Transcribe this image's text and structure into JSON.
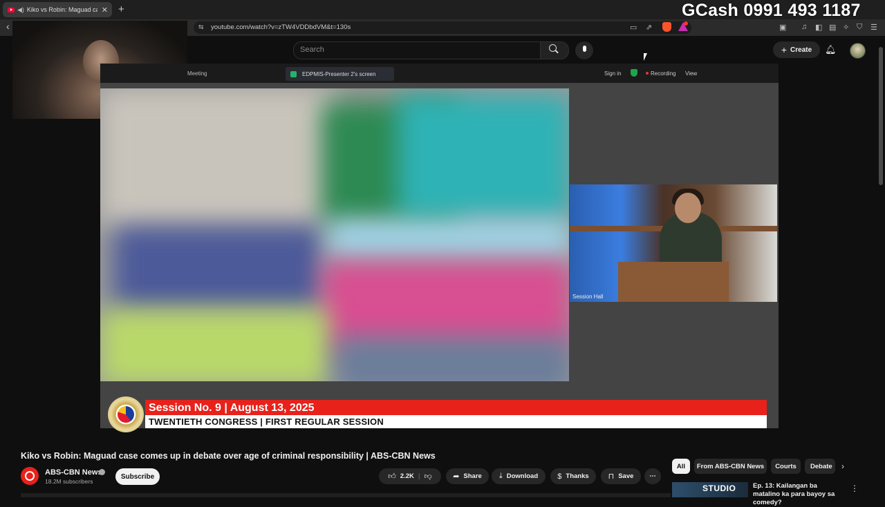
{
  "browser": {
    "tab_title": "Kiko vs Robin: Maguad case c",
    "tab_close": "✕",
    "new_tab": "+",
    "url": "youtube.com/watch?v=zTW4VDDbdVM&t=130s"
  },
  "overlay": {
    "gcash": "GCash 0991 493 1187"
  },
  "youtube": {
    "search_placeholder": "Search",
    "create_label": "Create"
  },
  "video": {
    "zoom": {
      "meeting_label": "Meeting",
      "presenter_label": "EDPMIS-Presenter 2's screen",
      "sign_in": "Sign in",
      "recording": "Recording",
      "view": "View"
    },
    "session_cam_label": "Session Hall",
    "lower_third": {
      "line1": "Session No. 9 | August 13, 2025",
      "line2": "TWENTIETH  CONGRESS | FIRST REGULAR SESSION"
    }
  },
  "watch": {
    "title": "Kiko vs Robin: Maguad case comes up in debate over age of criminal responsibility | ABS-CBN News",
    "channel_name": "ABS-CBN News",
    "subscribers": "18.2M subscribers",
    "subscribe_label": "Subscribe",
    "likes": "2.2K",
    "share_label": "Share",
    "download_label": "Download",
    "thanks_label": "Thanks",
    "save_label": "Save",
    "more_label": "⋯"
  },
  "chips": [
    "All",
    "From ABS-CBN News",
    "Courts",
    "Debate"
  ],
  "recommended": {
    "thumb_text": "STUDIO",
    "title": "Ep. 13: Kailangan ba matalino ka para bayoy sa comedy?"
  },
  "colors": {
    "accent_red": "#e8211b",
    "background": "#0f0f0f"
  }
}
